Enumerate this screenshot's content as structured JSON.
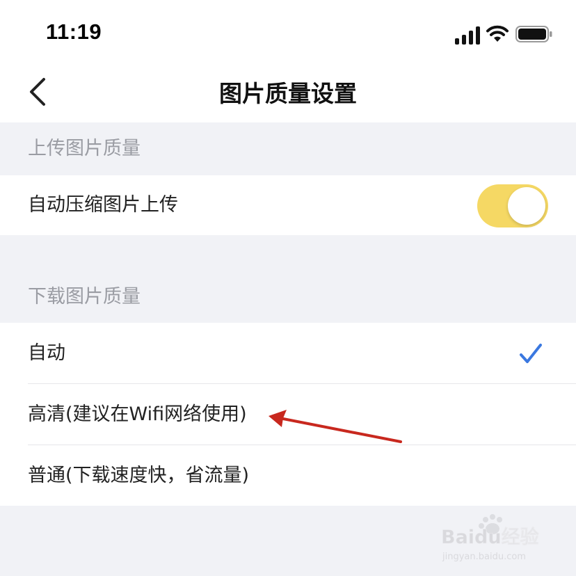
{
  "status_bar": {
    "time": "11:19",
    "signal_icon": "cellular-signal-icon",
    "wifi_icon": "wifi-icon",
    "battery_icon": "battery-icon"
  },
  "nav": {
    "back_icon": "chevron-left-icon",
    "title": "图片质量设置"
  },
  "upload_section": {
    "header": "上传图片质量",
    "auto_compress": {
      "label": "自动压缩图片上传",
      "enabled": true,
      "toggle_color": "#f5d864"
    }
  },
  "download_section": {
    "header": "下载图片质量",
    "options": [
      {
        "label": "自动",
        "selected": true
      },
      {
        "label": "高清(建议在Wifi网络使用)",
        "selected": false
      },
      {
        "label": "普通(下载速度快，省流量)",
        "selected": false
      }
    ],
    "check_color": "#3a78e0"
  },
  "annotation": {
    "type": "red-arrow",
    "color": "#c8281e",
    "points_to": "高清(建议在Wifi网络使用)"
  },
  "watermark": {
    "brand": "Baidu经验",
    "url": "jingyan.baidu.com"
  }
}
